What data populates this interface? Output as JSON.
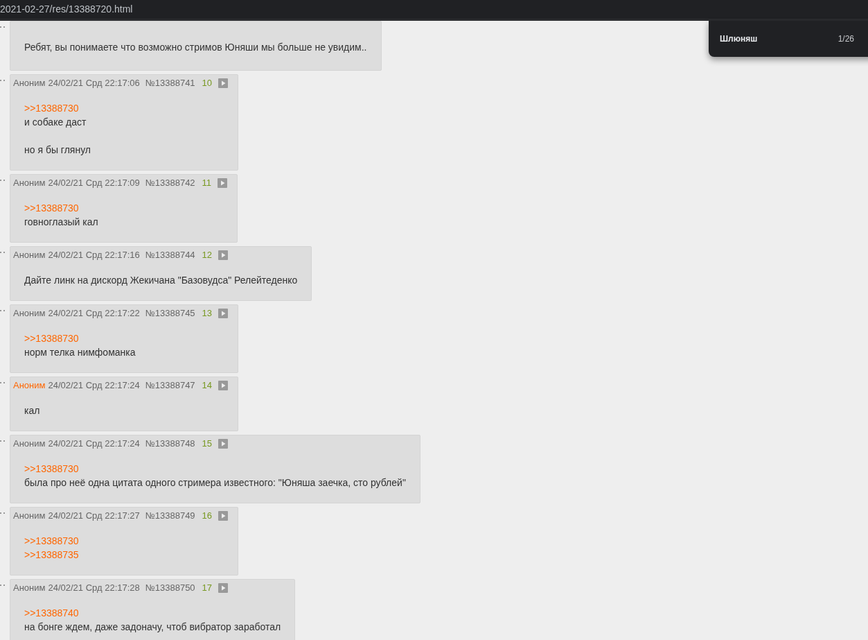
{
  "address_bar": {
    "url": "2021-02-27/res/13388720.html"
  },
  "find_popup": {
    "query": "Шлюняш",
    "count": "1/26"
  },
  "posts": [
    {
      "paragraphs": [
        [
          {
            "kind": "text",
            "text": "Ребят, вы понимаете что возможно стримов Юняши мы больше не увидим.."
          }
        ]
      ]
    },
    {
      "author": "Аноним",
      "author_highlighted": false,
      "date": "24/02/21 Срд 22:17:06",
      "number": "№13388741",
      "index": "10",
      "paragraphs": [
        [
          {
            "kind": "quote",
            "text": ">>13388730"
          },
          {
            "kind": "text",
            "text": "и собаке даст"
          }
        ],
        [
          {
            "kind": "text",
            "text": "но я бы глянул"
          }
        ]
      ]
    },
    {
      "author": "Аноним",
      "author_highlighted": false,
      "date": "24/02/21 Срд 22:17:09",
      "number": "№13388742",
      "index": "11",
      "paragraphs": [
        [
          {
            "kind": "quote",
            "text": ">>13388730"
          },
          {
            "kind": "text",
            "text": "говноглазый кал"
          }
        ]
      ]
    },
    {
      "author": "Аноним",
      "author_highlighted": false,
      "date": "24/02/21 Срд 22:17:16",
      "number": "№13388744",
      "index": "12",
      "paragraphs": [
        [
          {
            "kind": "text",
            "text": "Дайте линк на дискорд Жекичана \"Базовудса\" Релейтеденко"
          }
        ]
      ]
    },
    {
      "author": "Аноним",
      "author_highlighted": false,
      "date": "24/02/21 Срд 22:17:22",
      "number": "№13388745",
      "index": "13",
      "paragraphs": [
        [
          {
            "kind": "quote",
            "text": ">>13388730"
          },
          {
            "kind": "text",
            "text": "норм телка нимфоманка"
          }
        ]
      ]
    },
    {
      "author": "Аноним",
      "author_highlighted": true,
      "date": "24/02/21 Срд 22:17:24",
      "number": "№13388747",
      "index": "14",
      "paragraphs": [
        [
          {
            "kind": "text",
            "text": "кал"
          }
        ]
      ]
    },
    {
      "author": "Аноним",
      "author_highlighted": false,
      "date": "24/02/21 Срд 22:17:24",
      "number": "№13388748",
      "index": "15",
      "paragraphs": [
        [
          {
            "kind": "quote",
            "text": ">>13388730"
          },
          {
            "kind": "text",
            "text": "была про неё одна цитата одного стримера известного: \"Юняша заечка, сто рублей\""
          }
        ]
      ]
    },
    {
      "author": "Аноним",
      "author_highlighted": false,
      "date": "24/02/21 Срд 22:17:27",
      "number": "№13388749",
      "index": "16",
      "paragraphs": [
        [
          {
            "kind": "quote",
            "text": ">>13388730"
          },
          {
            "kind": "quote",
            "text": ">>13388735"
          }
        ]
      ]
    },
    {
      "author": "Аноним",
      "author_highlighted": false,
      "date": "24/02/21 Срд 22:17:28",
      "number": "№13388750",
      "index": "17",
      "paragraphs": [
        [
          {
            "kind": "quote",
            "text": ">>13388740"
          },
          {
            "kind": "text",
            "text": "на бонге ждем, даже задоначу, чтоб вибратор заработал"
          }
        ]
      ]
    }
  ]
}
